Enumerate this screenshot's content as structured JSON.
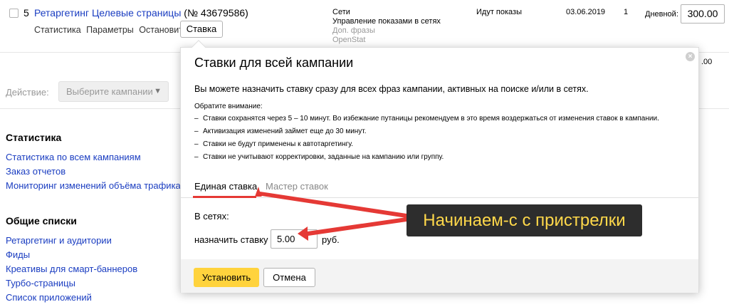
{
  "campaign": {
    "number": "5",
    "title": "Ретаргетинг Целевые страницы",
    "id_text": "(№ 43679586)",
    "links": [
      "Статистика",
      "Параметры",
      "Остановить"
    ],
    "bid_button": "Ставка",
    "networks": {
      "line1": "Сети",
      "line2": "Управление показами в сетях",
      "line3": "Доп. фразы",
      "line4": "OpenStat"
    },
    "status": "Идут показы",
    "date": "03.06.2019",
    "count": "1",
    "daily_label": "Дневной:",
    "daily_value": "300.00",
    "partial_value": ".00"
  },
  "action": {
    "label": "Действие:",
    "select_placeholder": "Выберите кампании"
  },
  "sidebar": {
    "stats_title": "Статистика",
    "stats_links": [
      "Статистика по всем кампаниям",
      "Заказ отчетов",
      "Мониторинг изменений объёма трафика"
    ],
    "lists_title": "Общие списки",
    "lists_links": [
      "Ретаргетинг и аудитории",
      "Фиды",
      "Креативы для смарт-баннеров",
      "Турбо-страницы",
      "Список приложений"
    ]
  },
  "popup": {
    "title": "Ставки для всей кампании",
    "description": "Вы можете назначить ставку сразу для всех фраз кампании, активных на поиске и/или в сетях.",
    "notice_label": "Обратите внимание:",
    "notices": [
      "Ставки сохранятся через 5 – 10 минут. Во избежание путаницы рекомендуем в это время воздержаться от изменения ставок в кампании.",
      "Активизация изменений займет еще до 30 минут.",
      "Ставки не будут применены к автотаргетингу.",
      "Ставки не учитывают корректировки, заданные на кампанию или группу."
    ],
    "tabs": [
      "Единая ставка",
      "Мастер ставок"
    ],
    "in_networks": "В сетях:",
    "assign_label": "назначить ставку",
    "rate_value": "5.00",
    "currency": "руб.",
    "submit": "Установить",
    "cancel": "Отмена"
  },
  "annotation": {
    "text": "Начинаем-с с пристрелки"
  },
  "colors": {
    "link": "#1a3dc1",
    "accent_yellow": "#ffd33d",
    "tab_underline": "#e53935",
    "annotation_bg": "#2d2d2d",
    "annotation_text": "#ffd84a",
    "arrow": "#e53935"
  }
}
